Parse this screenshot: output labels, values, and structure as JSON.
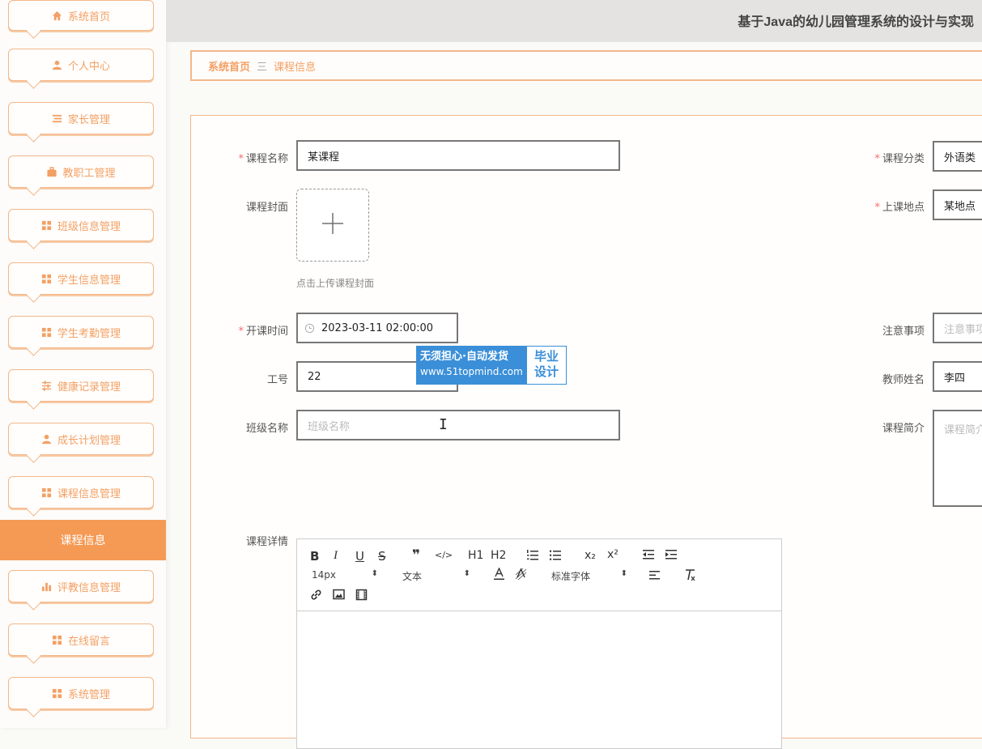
{
  "header": {
    "title": "基于Java的幼儿园管理系统的设计与实现"
  },
  "sidebar": {
    "items": [
      {
        "label": "系统首页",
        "icon": "home-icon"
      },
      {
        "label": "个人中心",
        "icon": "user-icon"
      },
      {
        "label": "家长管理",
        "icon": "list-icon"
      },
      {
        "label": "教职工管理",
        "icon": "briefcase-icon"
      },
      {
        "label": "班级信息管理",
        "icon": "grid-icon"
      },
      {
        "label": "学生信息管理",
        "icon": "grid-icon"
      },
      {
        "label": "学生考勤管理",
        "icon": "grid-icon"
      },
      {
        "label": "健康记录管理",
        "icon": "sliders-icon"
      },
      {
        "label": "成长计划管理",
        "icon": "user-icon"
      },
      {
        "label": "课程信息管理",
        "icon": "grid-icon"
      },
      {
        "label": "评教信息管理",
        "icon": "bar-chart-icon"
      },
      {
        "label": "在线留言",
        "icon": "grid-icon"
      },
      {
        "label": "系统管理",
        "icon": "grid-icon"
      }
    ],
    "active_sub": "课程信息"
  },
  "breadcrumb": {
    "home": "系统首页",
    "separator": "三",
    "current": "课程信息"
  },
  "form": {
    "course_name": {
      "label": "课程名称",
      "value": "某课程"
    },
    "course_category": {
      "label": "课程分类",
      "value": "外语类"
    },
    "course_cover": {
      "label": "课程封面",
      "hint": "点击上传课程封面"
    },
    "location": {
      "label": "上课地点",
      "value": "某地点"
    },
    "start_time": {
      "label": "开课时间",
      "value": "2023-03-11 02:00:00"
    },
    "notes": {
      "label": "注意事项",
      "placeholder": "注意事项"
    },
    "staff_id": {
      "label": "工号",
      "value": "22"
    },
    "teacher_name": {
      "label": "教师姓名",
      "value": "李四"
    },
    "class_name": {
      "label": "班级名称",
      "placeholder": "班级名称"
    },
    "course_intro": {
      "label": "课程简介",
      "placeholder": "课程简介"
    },
    "course_detail": {
      "label": "课程详情"
    }
  },
  "editor": {
    "font_size": "14px",
    "block_type": "文本",
    "font_family": "标准字体",
    "buttons": [
      "B",
      "I",
      "U",
      "S",
      "❞",
      "</>",
      "H1",
      "H2",
      "ol",
      "ul",
      "x₂",
      "x²",
      "outdent",
      "indent",
      "color",
      "background",
      "align",
      "clear",
      "link",
      "image",
      "video"
    ]
  },
  "watermark": {
    "line1": "无须担心·自动发货",
    "line2": "www.51topmind.com",
    "badge1": "毕业",
    "badge2": "设计"
  }
}
